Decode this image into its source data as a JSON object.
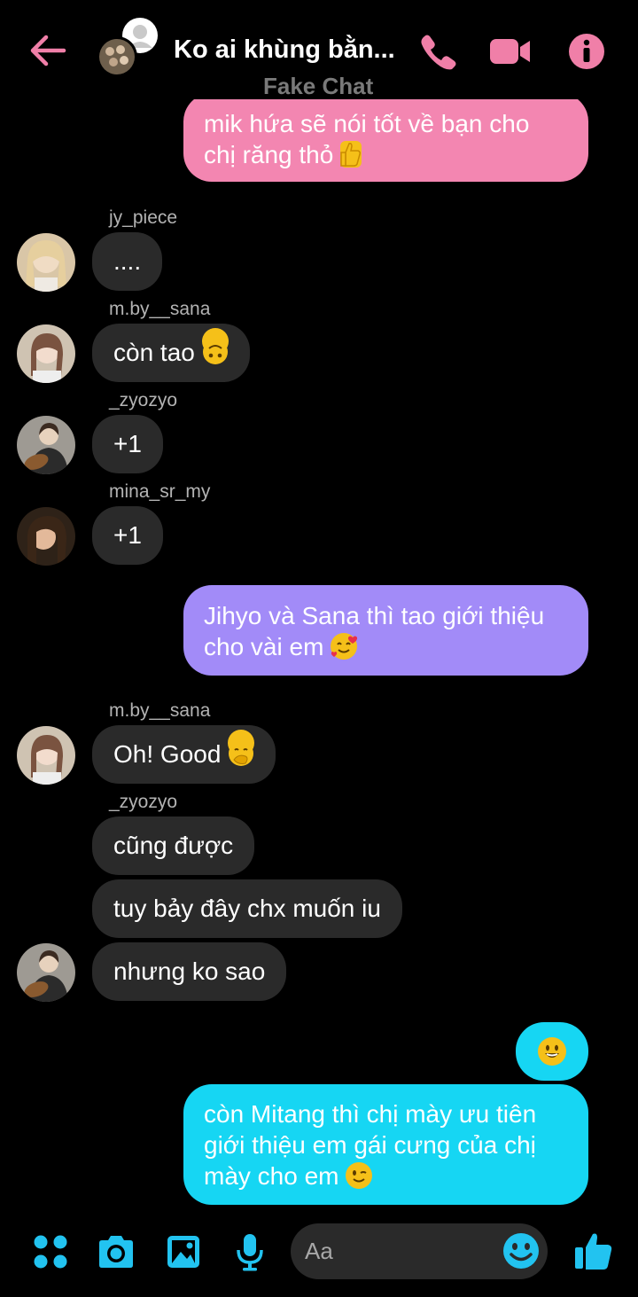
{
  "header": {
    "title": "Ko ai khùng bằn...",
    "subtitle": "Fake Chat",
    "back_icon": "arrow-left-icon",
    "call_icon": "phone-icon",
    "video_icon": "video-camera-icon",
    "info_icon": "info-icon",
    "accent_color": "#f07fa8"
  },
  "messages": [
    {
      "type": "outgoing",
      "text": "mik hứa sẽ nói tốt về bạn cho chị răng thỏ",
      "emoji": "thumbs-up",
      "color": "#f386b1"
    },
    {
      "type": "incoming",
      "sender": "jy_piece",
      "text": "...."
    },
    {
      "type": "incoming",
      "sender": "m.by__sana",
      "text": "còn tao",
      "emoji": "upside-down-face"
    },
    {
      "type": "incoming",
      "sender": "_zyozyo",
      "text": "+1"
    },
    {
      "type": "incoming",
      "sender": "mina_sr_my",
      "text": "+1"
    },
    {
      "type": "outgoing",
      "text": "Jihyo và Sana thì tao giới thiệu cho vài em",
      "emoji": "smiling-face-with-hearts",
      "color": "#a28bf8"
    },
    {
      "type": "incoming",
      "sender": "m.by__sana",
      "text": "Oh! Good",
      "emoji": "face-with-hand-over-mouth"
    },
    {
      "type": "incoming",
      "sender": "_zyozyo",
      "text": "cũng được"
    },
    {
      "type": "incoming",
      "text": "tuy bảy đây chx muốn iu"
    },
    {
      "type": "incoming",
      "text": "nhưng ko sao"
    },
    {
      "type": "outgoing",
      "text": "",
      "emoji": "grinning-face",
      "color": "#16d6f3"
    },
    {
      "type": "outgoing",
      "text": "còn Mitang thì chị mày ưu tiên giới thiệu em gái cưng của chị mày cho em",
      "emoji": "winking-face",
      "color": "#16d6f3"
    }
  ],
  "composer": {
    "placeholder": "Aa",
    "icons": [
      "more-apps-icon",
      "camera-icon",
      "image-icon",
      "microphone-icon",
      "emoji-icon",
      "thumbs-up-icon"
    ],
    "accent_color": "#22c3f0"
  }
}
